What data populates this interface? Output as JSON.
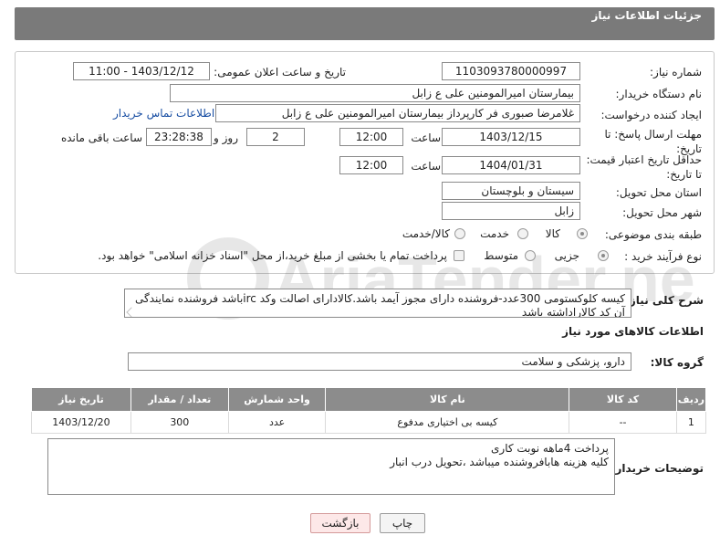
{
  "header": {
    "title": "جزئیات اطلاعات نیاز"
  },
  "form": {
    "need_number": {
      "label": "شماره نیاز:",
      "value": "1103093780000997"
    },
    "announce_datetime": {
      "label": "تاریخ و ساعت اعلان عمومی:",
      "value": "1403/12/12 - 11:00"
    },
    "buyer_org": {
      "label": "نام دستگاه خریدار:",
      "value": "بیمارستان امیرالمومنین علی  ع  زابل"
    },
    "requester": {
      "label": "ایجاد کننده درخواست:",
      "value": "غلامرضا صبوری فر کارپرداز بیمارستان امیرالمومنین علی  ع  زابل",
      "contact_link": "اطلاعات تماس خریدار"
    },
    "reply_deadline": {
      "label": "مهلت ارسال پاسخ: تا تاریخ:",
      "date": "1403/12/15",
      "time_label": "ساعت",
      "time": "12:00",
      "days": "2",
      "days_label": "روز و",
      "remaining": "23:28:38",
      "remaining_label": "ساعت باقی مانده"
    },
    "price_validity": {
      "label": "حداقل تاریخ اعتبار قیمت: تا تاریخ:",
      "date": "1404/01/31",
      "time_label": "ساعت",
      "time": "12:00"
    },
    "province": {
      "label": "استان محل تحویل:",
      "value": "سیستان و بلوچستان"
    },
    "city": {
      "label": "شهر محل تحویل:",
      "value": "زابل"
    },
    "category": {
      "label": "طبقه بندی موضوعی:",
      "options": [
        "کالا",
        "خدمت",
        "کالا/خدمت"
      ]
    },
    "process": {
      "label": "نوع فرآیند خرید :",
      "options": [
        "جزیی",
        "متوسط"
      ],
      "note": "پرداخت تمام یا بخشی از مبلغ خرید،از محل \"اسناد خزانه اسلامی\" خواهد بود."
    }
  },
  "description": {
    "label": "شرح کلی نیاز:",
    "text": "کیسه کلوکستومی 300عدد-فروشنده دارای مجوز آیمد باشد.کالادارای اصالت وکد ircباشد فروشنده نمایندگی آن کد کالاراداشته باشد"
  },
  "goods_info": {
    "title": "اطلاعات کالاهای مورد نیاز"
  },
  "goods_group": {
    "label": "گروه کالا:",
    "value": "دارو، پزشکی و سلامت"
  },
  "table": {
    "headers": [
      "ردیف",
      "کد کالا",
      "نام کالا",
      "واحد شمارش",
      "تعداد / مقدار",
      "تاریخ نیاز"
    ],
    "rows": [
      [
        "1",
        "--",
        "کیسه بی اختیاری مدفوع",
        "عدد",
        "300",
        "1403/12/20"
      ]
    ]
  },
  "buyer_notes": {
    "label": "توضیحات خریدار:",
    "lines": [
      "پرداخت 4ماهه نوبت کاری",
      "کلیه هزینه هابافروشنده میباشد ،تحویل درب انبار"
    ]
  },
  "buttons": {
    "print": "چاپ",
    "back": "بازگشت"
  },
  "watermark": {
    "text": "AriaTender.neT"
  }
}
